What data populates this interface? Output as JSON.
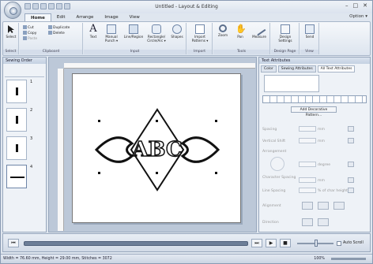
{
  "window": {
    "title": "Untitled - Layout & Editing"
  },
  "tabs": [
    "Home",
    "Edit",
    "Arrange",
    "Image",
    "View"
  ],
  "options": "Option ▾",
  "ribbon": {
    "select": "Select",
    "clipboard": {
      "cut": "Cut",
      "copy": "Copy",
      "paste": "Paste",
      "duplicate": "Duplicate",
      "delete": "Delete"
    },
    "input": [
      "Text",
      "Manual Punch ▾",
      "Line/Region",
      "Rectangle/ Circle/Arc ▾",
      "Shapes"
    ],
    "import": "Import Patterns ▾",
    "tools": [
      "Zoom",
      "Pan",
      "Measure"
    ],
    "design": "Design Settings",
    "view": "Send",
    "groups": [
      "Select",
      "Clipboard",
      "Input",
      "Import",
      "Tools",
      "Design Page",
      "View"
    ]
  },
  "sewing_order": {
    "title": "Sewing Order",
    "items": [
      "1",
      "2",
      "3",
      "4"
    ]
  },
  "text_attributes": {
    "title": "Text Attributes",
    "tabs": [
      "Color",
      "Sewing Attributes",
      "All Text Attributes"
    ],
    "add_button": "Add Decorative Pattern...",
    "rows": [
      {
        "label": "Spacing",
        "unit": "mm"
      },
      {
        "label": "Vertical Shift",
        "unit": "mm"
      },
      {
        "label": "Arrangement",
        "unit": ""
      },
      {
        "label": "",
        "unit": "degree"
      },
      {
        "label": "Character Spacing",
        "unit": "mm"
      },
      {
        "label": "Line Spacing",
        "unit": "% of char height"
      },
      {
        "label": "Alignment",
        "unit": ""
      },
      {
        "label": "Direction",
        "unit": ""
      }
    ]
  },
  "player": {
    "auto_scroll": "Auto Scroll"
  },
  "status": {
    "text": "Width = 76.60 mm, Height = 29.00 mm, Stitches = 3072",
    "zoom": "100%"
  },
  "design_text": "ABC"
}
